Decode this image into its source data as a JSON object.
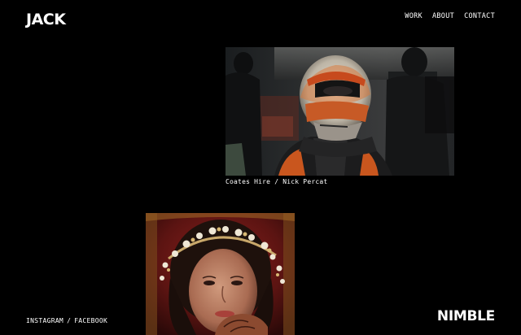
{
  "header": {
    "logo": "JACK",
    "nav": [
      {
        "label": "WORK"
      },
      {
        "label": "ABOUT"
      },
      {
        "label": "CONTACT"
      }
    ]
  },
  "projects": [
    {
      "caption": "Coates Hire / Nick Percat",
      "image": "race-driver-helmet-photo"
    },
    {
      "caption": "",
      "image": "woman-floral-headpiece-photo"
    }
  ],
  "footer": {
    "social": [
      {
        "label": "INSTAGRAM"
      },
      {
        "label": "FACEBOOK"
      }
    ],
    "separator": "/",
    "brand": "NIMBLE"
  }
}
